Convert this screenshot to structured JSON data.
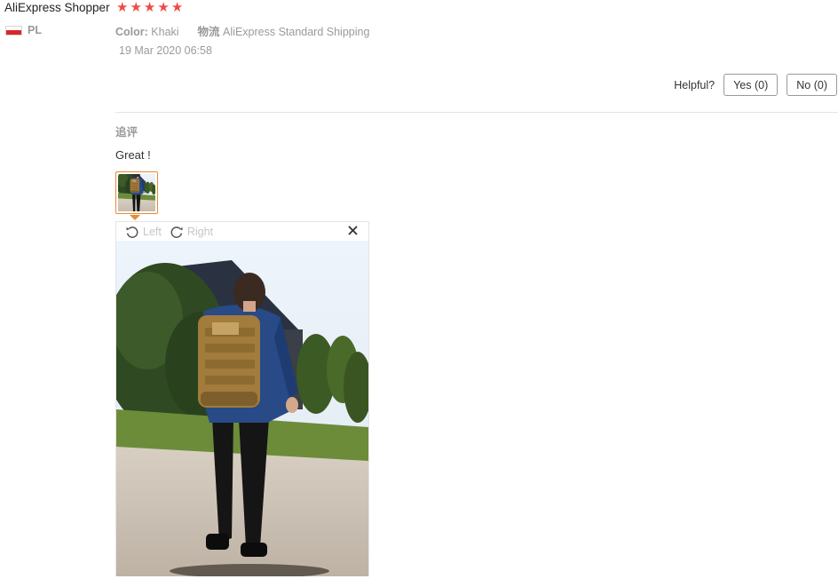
{
  "review": {
    "reviewer": "AliExpress Shopper",
    "rating": 5,
    "country_code": "PL",
    "color_label": "Color:",
    "color_value": "Khaki",
    "shipping_label": "物流",
    "shipping_value": "AliExpress Standard Shipping",
    "date": "19 Mar 2020 06:58"
  },
  "helpful": {
    "label": "Helpful?",
    "yes": "Yes (0)",
    "no": "No (0)"
  },
  "followup": {
    "label": "追评",
    "text": "Great !"
  },
  "viewer": {
    "rotate_left": "Left",
    "rotate_right": "Right"
  },
  "icons": {
    "star": "star-icon",
    "rotate_left": "rotate-left-icon",
    "rotate_right": "rotate-right-icon",
    "close": "close-icon"
  },
  "colors": {
    "star": "#f04a46",
    "thumb_border": "#e88a2f",
    "flag_red": "#d62828"
  }
}
